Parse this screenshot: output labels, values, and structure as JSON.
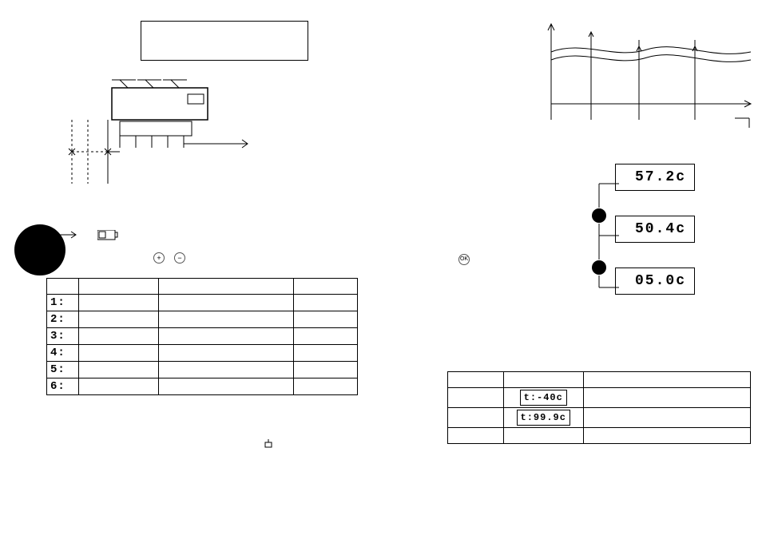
{
  "top_box_note": "",
  "param_table": {
    "headers": [
      "",
      "",
      "",
      ""
    ],
    "rows": [
      {
        "num": "1:",
        "c1": "",
        "c2": "",
        "c3": ""
      },
      {
        "num": "2:",
        "c1": "",
        "c2": "",
        "c3": ""
      },
      {
        "num": "3:",
        "c1": "",
        "c2": "",
        "c3": ""
      },
      {
        "num": "4:",
        "c1": "",
        "c2": "",
        "c3": ""
      },
      {
        "num": "5:",
        "c1": "",
        "c2": "",
        "c3": ""
      },
      {
        "num": "6:",
        "c1": "",
        "c2": "",
        "c3": ""
      }
    ]
  },
  "buttons": {
    "plus": "+",
    "minus": "−",
    "ok": "OK"
  },
  "lcd_sequence": {
    "r1": "57.2c",
    "r2": "50.4c",
    "r3": "05.0c"
  },
  "error_table": {
    "row1_disp": "t:-40c",
    "row1_label": "",
    "row1_desc": "",
    "row2_disp": "t:99.9c",
    "row2_label": "",
    "row2_desc": "",
    "row3_label": "",
    "row3_desc": ""
  }
}
